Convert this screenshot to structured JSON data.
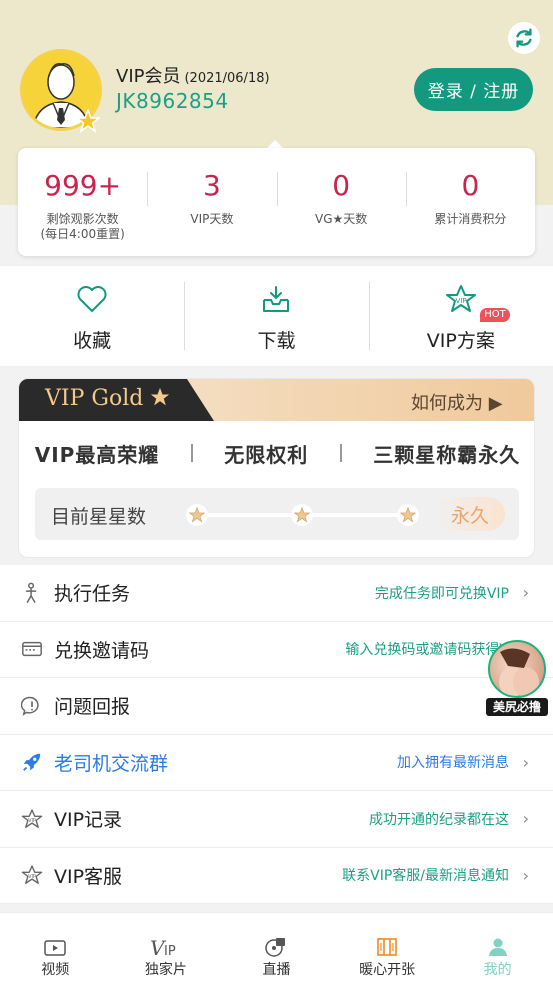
{
  "header": {
    "vip_label": "VIP会员",
    "vip_date": "(2021/06/18)",
    "user_id": "JK8962854",
    "login_button": "登录 / 注册"
  },
  "stats": [
    {
      "value": "999+",
      "label_line1": "剩馀观影次数",
      "label_line2": "(每日4:00重置)"
    },
    {
      "value": "3",
      "label_line1": "VIP天数",
      "label_line2": ""
    },
    {
      "value": "0",
      "label_line1": "VG★天数",
      "label_line2": ""
    },
    {
      "value": "0",
      "label_line1": "累计消费积分",
      "label_line2": ""
    }
  ],
  "quick_actions": [
    {
      "label": "收藏",
      "icon": "heart-icon"
    },
    {
      "label": "下载",
      "icon": "download-icon"
    },
    {
      "label": "VIP方案",
      "icon": "vip-star-icon",
      "badge": "HOT"
    }
  ],
  "gold": {
    "title": "VIP Gold",
    "how_to": "如何成为",
    "perks": [
      "VIP最高荣耀",
      "无限权利",
      "三颗星称霸永久"
    ],
    "stars_label": "目前星星数",
    "forever": "永久"
  },
  "menu": [
    {
      "title": "执行任务",
      "hint": "完成任务即可兑换VIP",
      "icon": "task-person-icon",
      "highlight": false
    },
    {
      "title": "兑换邀请码",
      "hint": "输入兑换码或邀请码获得V",
      "icon": "card-icon",
      "highlight": false
    },
    {
      "title": "问题回报",
      "hint": "",
      "icon": "alert-bubble-icon",
      "highlight": false
    },
    {
      "title": "老司机交流群",
      "hint": "加入拥有最新消息",
      "icon": "rocket-icon",
      "highlight": true
    },
    {
      "title": "VIP记录",
      "hint": "成功开通的纪录都在这",
      "icon": "vip-star-icon",
      "highlight": false
    },
    {
      "title": "VIP客服",
      "hint": "联系VIP客服/最新消息通知",
      "icon": "vip-star-icon",
      "highlight": false
    }
  ],
  "float_ad": {
    "label": "美尻必撸"
  },
  "tabbar": [
    {
      "label": "视频",
      "icon": "video-icon",
      "active": false
    },
    {
      "label": "独家片",
      "icon": "vip-logo-icon",
      "active": false
    },
    {
      "label": "直播",
      "icon": "live-icon",
      "active": false
    },
    {
      "label": "暖心开张",
      "icon": "gift-icon",
      "active": false
    },
    {
      "label": "我的",
      "icon": "profile-icon",
      "active": true
    }
  ],
  "colors": {
    "accent": "#13997f",
    "stat_value": "#c7254e",
    "header_bg": "#ede8cc",
    "link_blue": "#2c7be5"
  }
}
